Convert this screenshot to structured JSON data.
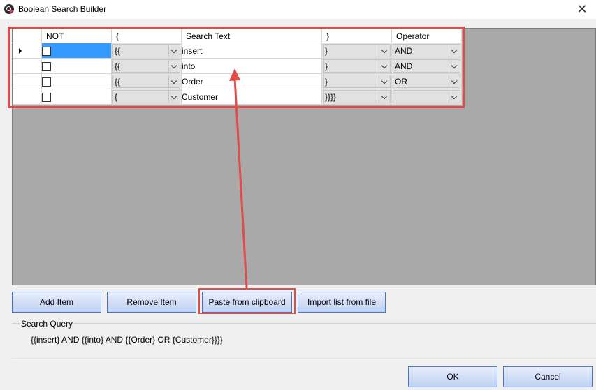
{
  "window": {
    "title": "Boolean Search Builder",
    "close_symbol": "✕"
  },
  "grid": {
    "columns": [
      "NOT",
      "{",
      "Search Text",
      "}",
      "Operator"
    ],
    "rows": [
      {
        "not_checked": false,
        "open": "{{",
        "text": "insert",
        "close": "}",
        "operator": "AND"
      },
      {
        "not_checked": false,
        "open": "{{",
        "text": "into",
        "close": "}",
        "operator": "AND"
      },
      {
        "not_checked": false,
        "open": "{{",
        "text": "Order",
        "close": "}",
        "operator": "OR"
      },
      {
        "not_checked": false,
        "open": "{",
        "text": "Customer",
        "close": "}}}}",
        "operator": ""
      }
    ]
  },
  "buttons": {
    "add": "Add Item",
    "remove": "Remove Item",
    "paste": "Paste from clipboard",
    "import": "Import list from file",
    "ok": "OK",
    "cancel": "Cancel"
  },
  "query": {
    "label": "Search Query",
    "value": "{{insert} AND {{into} AND {{Order} OR {Customer}}}}"
  },
  "colors": {
    "highlight": "#e04b4b",
    "selection": "#3399ff",
    "grid_background": "#a9a9a9"
  }
}
